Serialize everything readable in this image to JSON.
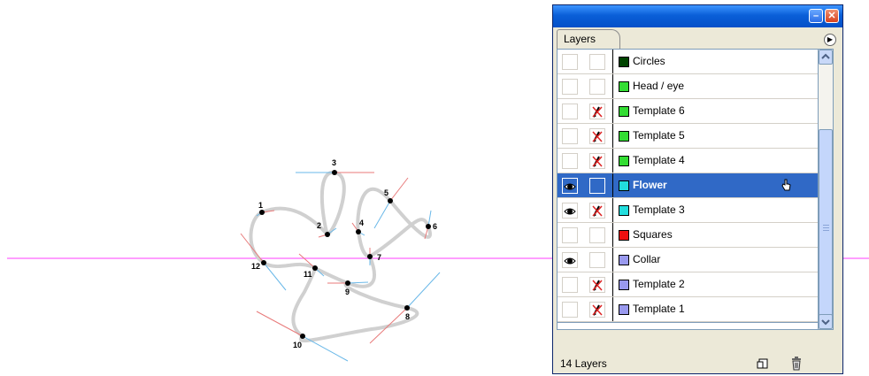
{
  "canvas": {
    "guide_color": "#ff3cff",
    "anchor_labels": [
      "1",
      "2",
      "3",
      "4",
      "5",
      "6",
      "7",
      "8",
      "9",
      "10",
      "11",
      "12"
    ]
  },
  "panel": {
    "tab_label": "Layers",
    "status_text": "14 Layers",
    "layers": [
      {
        "name": "Circles",
        "color": "#004400",
        "visible": false,
        "locked_hidden": false,
        "selected": false
      },
      {
        "name": "Head / eye",
        "color": "#33dd33",
        "visible": false,
        "locked_hidden": false,
        "selected": false
      },
      {
        "name": "Template 6",
        "color": "#33dd33",
        "visible": false,
        "locked_hidden": true,
        "selected": false
      },
      {
        "name": "Template 5",
        "color": "#33dd33",
        "visible": false,
        "locked_hidden": true,
        "selected": false
      },
      {
        "name": "Template 4",
        "color": "#33dd33",
        "visible": false,
        "locked_hidden": true,
        "selected": false
      },
      {
        "name": "Flower",
        "color": "#22dddd",
        "visible": true,
        "locked_hidden": false,
        "selected": true
      },
      {
        "name": "Template 3",
        "color": "#22dddd",
        "visible": true,
        "locked_hidden": true,
        "selected": false
      },
      {
        "name": "Squares",
        "color": "#ee1111",
        "visible": false,
        "locked_hidden": false,
        "selected": false
      },
      {
        "name": "Collar",
        "color": "#9999ee",
        "visible": true,
        "locked_hidden": false,
        "selected": false
      },
      {
        "name": "Template 2",
        "color": "#9999ee",
        "visible": false,
        "locked_hidden": true,
        "selected": false
      },
      {
        "name": "Template 1",
        "color": "#9999ee",
        "visible": false,
        "locked_hidden": true,
        "selected": false
      }
    ]
  }
}
